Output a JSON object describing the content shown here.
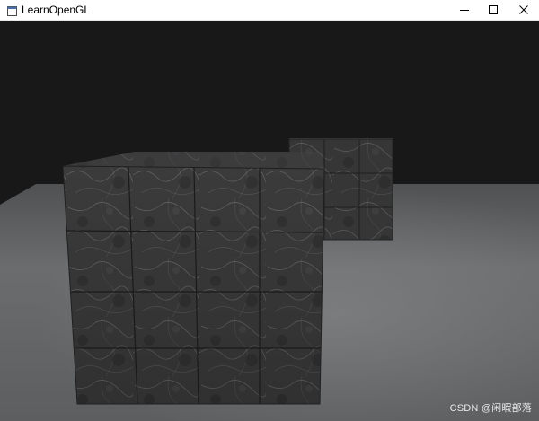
{
  "window": {
    "title": "LearnOpenGL",
    "icon": "app-window-icon",
    "controls": [
      "minimize-icon",
      "maximize-icon",
      "close-icon"
    ]
  },
  "viewport": {
    "clear_color": "#181818",
    "floor_color": "#6a6c6e",
    "cube_color": "#3a3a3a",
    "watermark": "CSDN @闲暇部落"
  }
}
